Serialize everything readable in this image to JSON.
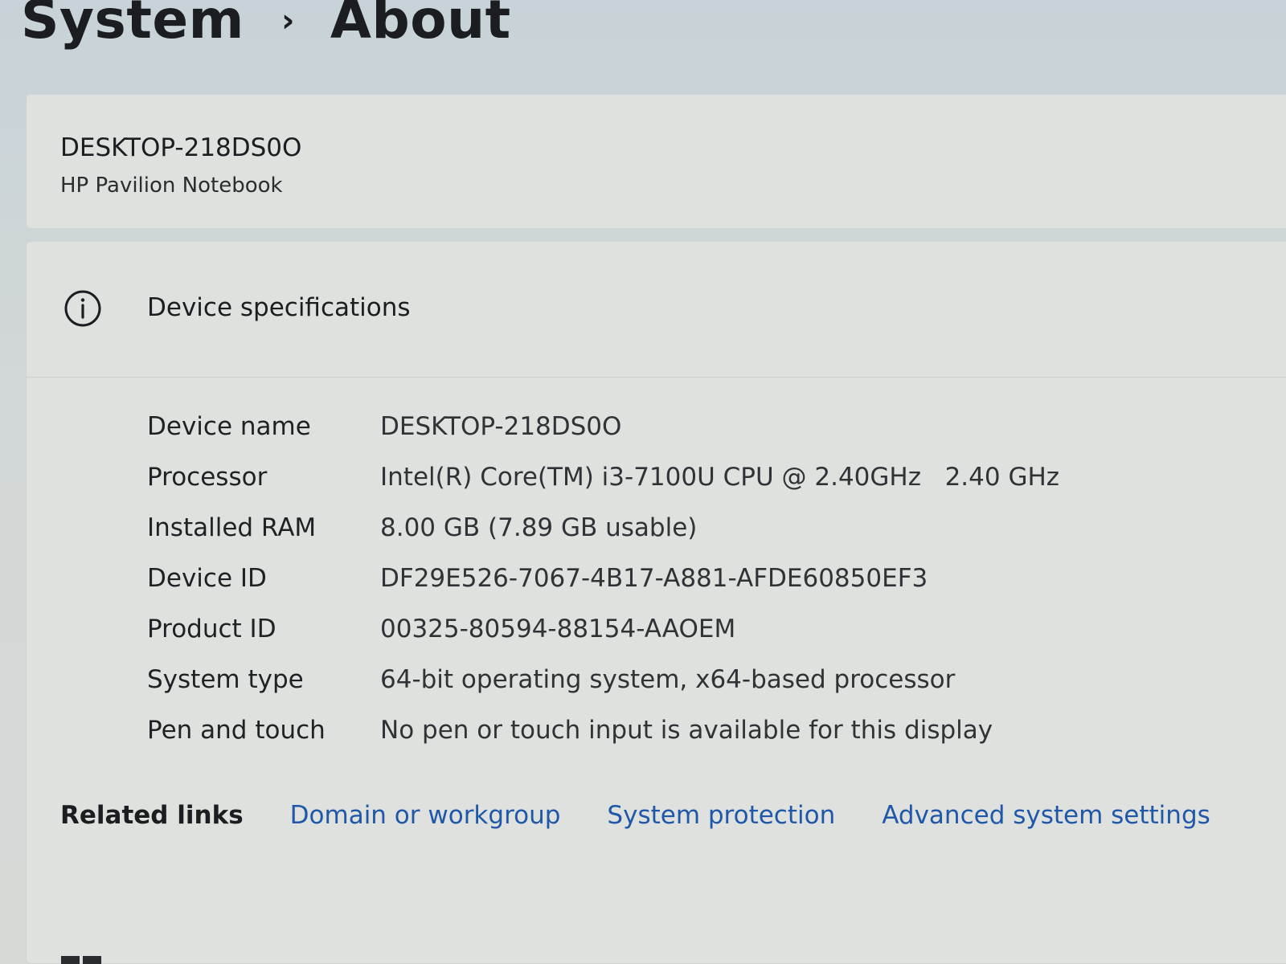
{
  "breadcrumb": {
    "parent": "System",
    "separator": "›",
    "current": "About"
  },
  "device_card": {
    "name": "DESKTOP-218DS0O",
    "model": "HP Pavilion Notebook"
  },
  "specs": {
    "icon": "info-icon",
    "title": "Device specifications",
    "rows": [
      {
        "label": "Device name",
        "value": "DESKTOP-218DS0O"
      },
      {
        "label": "Processor",
        "value": "Intel(R) Core(TM) i3-7100U CPU @ 2.40GHz   2.40 GHz"
      },
      {
        "label": "Installed RAM",
        "value": "8.00 GB (7.89 GB usable)"
      },
      {
        "label": "Device ID",
        "value": "DF29E526-7067-4B17-A881-AFDE60850EF3"
      },
      {
        "label": "Product ID",
        "value": "00325-80594-88154-AAOEM"
      },
      {
        "label": "System type",
        "value": "64-bit operating system, x64-based processor"
      },
      {
        "label": "Pen and touch",
        "value": "No pen or touch input is available for this display"
      }
    ]
  },
  "related": {
    "label": "Related links",
    "links": [
      "Domain or workgroup",
      "System protection",
      "Advanced system settings"
    ]
  },
  "colors": {
    "link": "#1f58a8",
    "card": "#dfe1df"
  }
}
